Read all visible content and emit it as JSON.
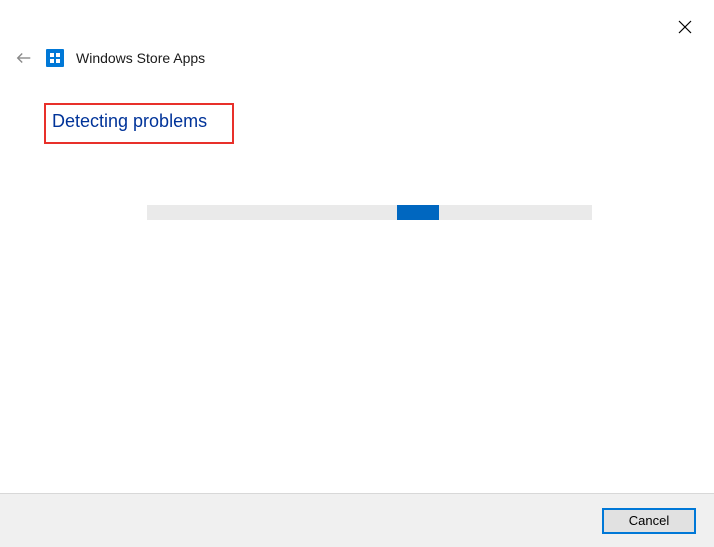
{
  "header": {
    "title": "Windows Store Apps"
  },
  "status": {
    "label": "Detecting problems"
  },
  "footer": {
    "cancel_label": "Cancel"
  },
  "colors": {
    "accent": "#0078d7",
    "highlight_border": "#e8302a",
    "link_text": "#003399"
  }
}
